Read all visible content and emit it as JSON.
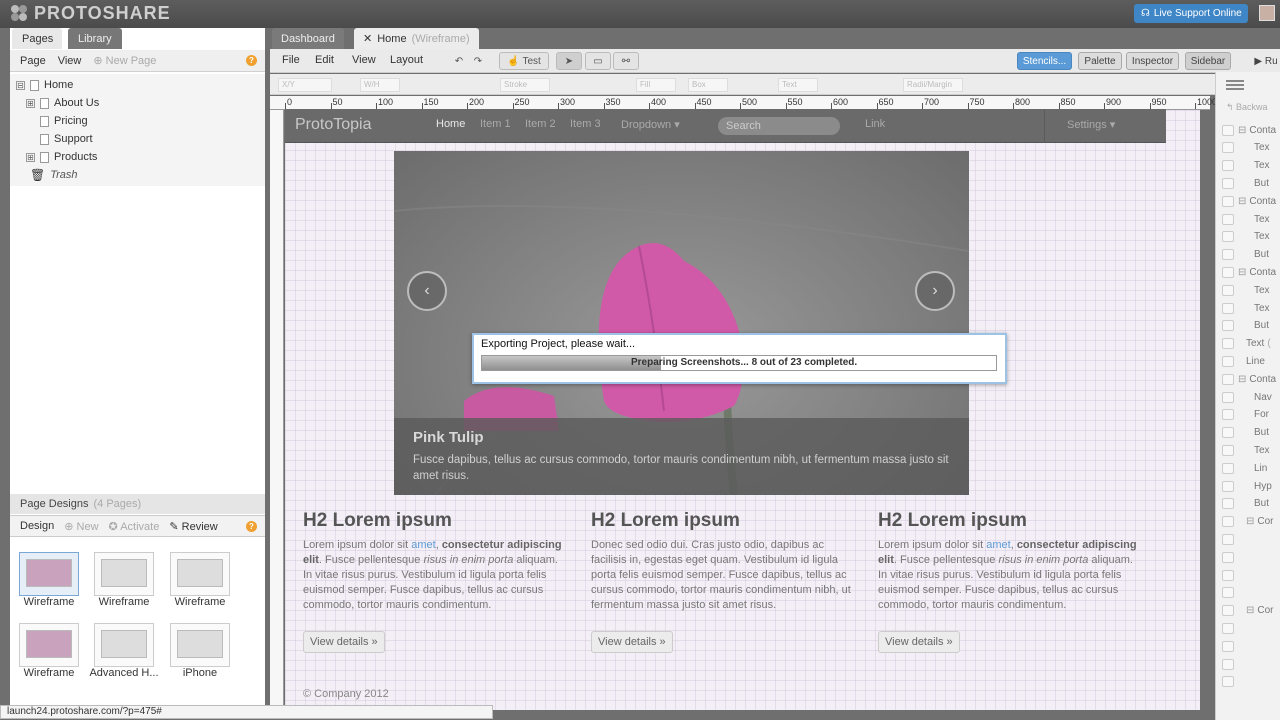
{
  "app": {
    "logo": "PROTOSHARE",
    "live_support": "Live Support Online",
    "status_url": "launch24.protoshare.com/?p=475#"
  },
  "left_tabs": [
    "Pages",
    "Library"
  ],
  "page_tools": {
    "page": "Page",
    "view": "View",
    "new_page": "New Page"
  },
  "tree": [
    {
      "label": "Home",
      "expander": "⊟",
      "indent": 0
    },
    {
      "label": "About Us",
      "expander": "⊞",
      "indent": 1
    },
    {
      "label": "Pricing",
      "expander": "",
      "indent": 1
    },
    {
      "label": "Support",
      "expander": "",
      "indent": 1
    },
    {
      "label": "Products",
      "expander": "⊞",
      "indent": 1
    },
    {
      "label": "Trash",
      "expander": "",
      "indent": 0
    }
  ],
  "page_designs": {
    "title": "Page Designs",
    "count": "(4 Pages)",
    "design": "Design",
    "new": "New",
    "activate": "Activate",
    "review": "Review",
    "thumbs": [
      "Wireframe",
      "Wireframe",
      "Wireframe",
      "Wireframe",
      "Advanced H...",
      "iPhone"
    ]
  },
  "doc_tabs": {
    "dashboard": "Dashboard",
    "home": "Home",
    "home_suffix": "(Wireframe)"
  },
  "menus": [
    "File",
    "Edit",
    "View",
    "Layout"
  ],
  "toolbar": {
    "test": "Test",
    "stencils": "Stencils...",
    "palette": "Palette",
    "inspector": "Inspector",
    "sidebar": "Sidebar",
    "run": "Ru"
  },
  "props": [
    "X/Y",
    "W/H",
    "Stroke",
    "Fill",
    "Box",
    "Text",
    "Radii/Margin"
  ],
  "ruler": [
    "0",
    "50",
    "100",
    "150",
    "200",
    "250",
    "300",
    "350",
    "400",
    "450",
    "500",
    "550",
    "600",
    "650",
    "700",
    "750",
    "800",
    "850",
    "900",
    "950",
    "1000"
  ],
  "site": {
    "brand": "ProtoTopia",
    "nav": [
      "Home",
      "Item 1",
      "Item 2",
      "Item 3",
      "Dropdown ▾"
    ],
    "search_placeholder": "Search",
    "link": "Link",
    "settings": "Settings ▾",
    "carousel": {
      "title": "Pink Tulip",
      "text": "Fusce dapibus, tellus ac cursus commodo, tortor mauris condimentum nibh, ut fermentum massa justo sit amet risus.",
      "prev": "‹",
      "next": "›"
    },
    "columns": [
      {
        "heading": "H2 Lorem ipsum",
        "p1": "Lorem ipsum dolor sit ",
        "link": "amet",
        "p2": ", ",
        "bold": "consectetur adipiscing elit",
        "p3": ". Fusce pellentesque ",
        "italic": "risus in enim porta",
        "p4": " aliquam. In vitae risus purus. Vestibulum id ligula porta felis euismod semper. Fusce dapibus, tellus ac cursus commodo, tortor mauris condimentum.",
        "button": "View details »"
      },
      {
        "heading": "H2 Lorem ipsum",
        "p1": "Donec sed odio dui. Cras justo odio, dapibus ac facilisis in, egestas eget quam. Vestibulum id ligula porta felis euismod semper. Fusce dapibus, tellus ac cursus commodo, tortor mauris condimentum nibh, ut fermentum massa justo sit amet risus.",
        "button": "View details »"
      },
      {
        "heading": "H2 Lorem ipsum",
        "p1": "Lorem ipsum dolor sit ",
        "link": "amet",
        "p2": ", ",
        "bold": "consectetur adipiscing elit",
        "p3": ". Fusce pellentesque ",
        "italic": "risus in enim porta",
        "p4": " aliquam. In vitae risus purus. Vestibulum id ligula porta felis euismod semper. Fusce dapibus, tellus ac cursus commodo, tortor mauris condimentum.",
        "button": "View details »"
      }
    ],
    "footer": "© Company 2012"
  },
  "dialog": {
    "title": "Exporting Project, please wait...",
    "progress_text": "Preparing Screenshots... 8 out of 23 completed.",
    "completed": 8,
    "total": 23
  },
  "inspector": {
    "back": "Backwa",
    "items": [
      {
        "label": "Conta",
        "tog": "⊟",
        "d": 0
      },
      {
        "label": "Tex",
        "d": 1
      },
      {
        "label": "Tex",
        "d": 1
      },
      {
        "label": "But",
        "d": 1
      },
      {
        "label": "Conta",
        "tog": "⊟",
        "d": 0
      },
      {
        "label": "Tex",
        "d": 1
      },
      {
        "label": "Tex",
        "d": 1
      },
      {
        "label": "But",
        "d": 1
      },
      {
        "label": "Conta",
        "tog": "⊟",
        "d": 0
      },
      {
        "label": "Tex",
        "d": 1
      },
      {
        "label": "Tex",
        "d": 1
      },
      {
        "label": "But",
        "d": 1
      },
      {
        "label": "Text",
        "extra": "(",
        "d": 0
      },
      {
        "label": "Line",
        "d": 0
      },
      {
        "label": "Conta",
        "tog": "⊟",
        "d": 0
      },
      {
        "label": "Nav",
        "d": 1
      },
      {
        "label": "For",
        "d": 1
      },
      {
        "label": "But",
        "d": 1
      },
      {
        "label": "Tex",
        "d": 1
      },
      {
        "label": "Lin",
        "d": 1
      },
      {
        "label": "Hyp",
        "d": 1
      },
      {
        "label": "But",
        "d": 1
      },
      {
        "label": "Cor",
        "tog": "⊟",
        "d": 1
      },
      {
        "label": "",
        "d": 2
      },
      {
        "label": "",
        "d": 2
      },
      {
        "label": "",
        "d": 2
      },
      {
        "label": "",
        "d": 2
      },
      {
        "label": "Cor",
        "tog": "⊟",
        "d": 1
      },
      {
        "label": "",
        "d": 2
      },
      {
        "label": "",
        "d": 2
      },
      {
        "label": "",
        "d": 2
      },
      {
        "label": "",
        "d": 2
      }
    ]
  }
}
